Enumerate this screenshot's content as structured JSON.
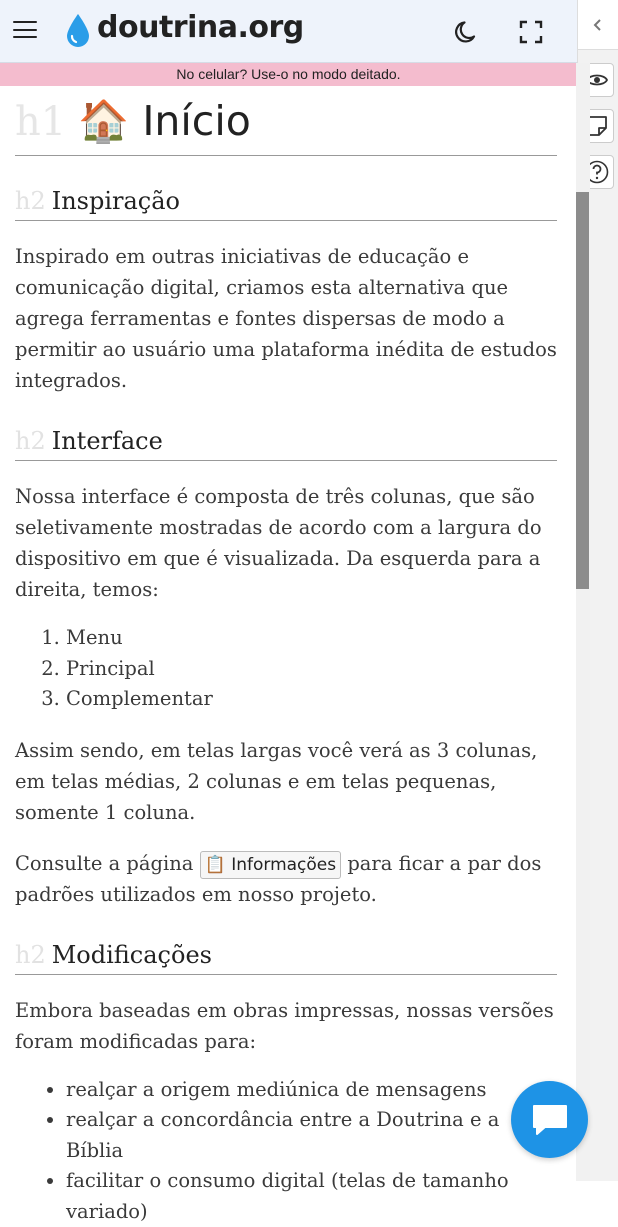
{
  "header": {
    "logo_text": "doutrina.org",
    "icons": [
      "menu-icon",
      "water-drop-icon",
      "moon-icon",
      "fullscreen-icon"
    ]
  },
  "banner": {
    "text": "No celular? Use-o no modo deitado."
  },
  "sidebar_right": {
    "icons": [
      "chevron-left-icon",
      "eye-icon",
      "note-icon",
      "help-icon"
    ]
  },
  "page": {
    "h1_tag": "h1",
    "title_emoji": "🏠",
    "title": "Início",
    "sections": {
      "inspiracao": {
        "tag": "h2",
        "heading": "Inspiração",
        "paragraph": "Inspirado em outras iniciativas de educação e comunicação digital, criamos esta alternativa que agrega ferramentas e fontes dispersas de modo a permitir ao usuário uma plataforma inédita de estudos integrados."
      },
      "interface": {
        "tag": "h2",
        "heading": "Interface",
        "paragraph1": "Nossa interface é composta de três colunas, que são seletivamente mostradas de acordo com a largura do dispositivo em que é visualizada. Da esquerda para a direita, temos:",
        "list": [
          "Menu",
          "Principal",
          "Complementar"
        ],
        "paragraph2": "Assim sendo, em telas largas você verá as 3 colunas, em telas médias, 2 colunas e em telas pequenas, somente 1 coluna.",
        "paragraph3_before": "Consulte a página ",
        "chip_emoji": "📋",
        "chip_label": "Informações",
        "paragraph3_after": " para ficar a par dos padrões utilizados em nosso projeto."
      },
      "modificacoes": {
        "tag": "h2",
        "heading": "Modificações",
        "paragraph": "Embora baseadas em obras impressas, nossas versões foram modificadas para:",
        "list": [
          "realçar a origem mediúnica de mensagens",
          "realçar a concordância entre a Doutrina e a Bíblia",
          "facilitar o consumo digital (telas de tamanho variado)"
        ]
      }
    }
  },
  "colors": {
    "header_bg": "#eef3fb",
    "banner_bg": "#f4bcce",
    "chat_button": "#1e93e6",
    "logo_drop": "#2a9de8"
  }
}
